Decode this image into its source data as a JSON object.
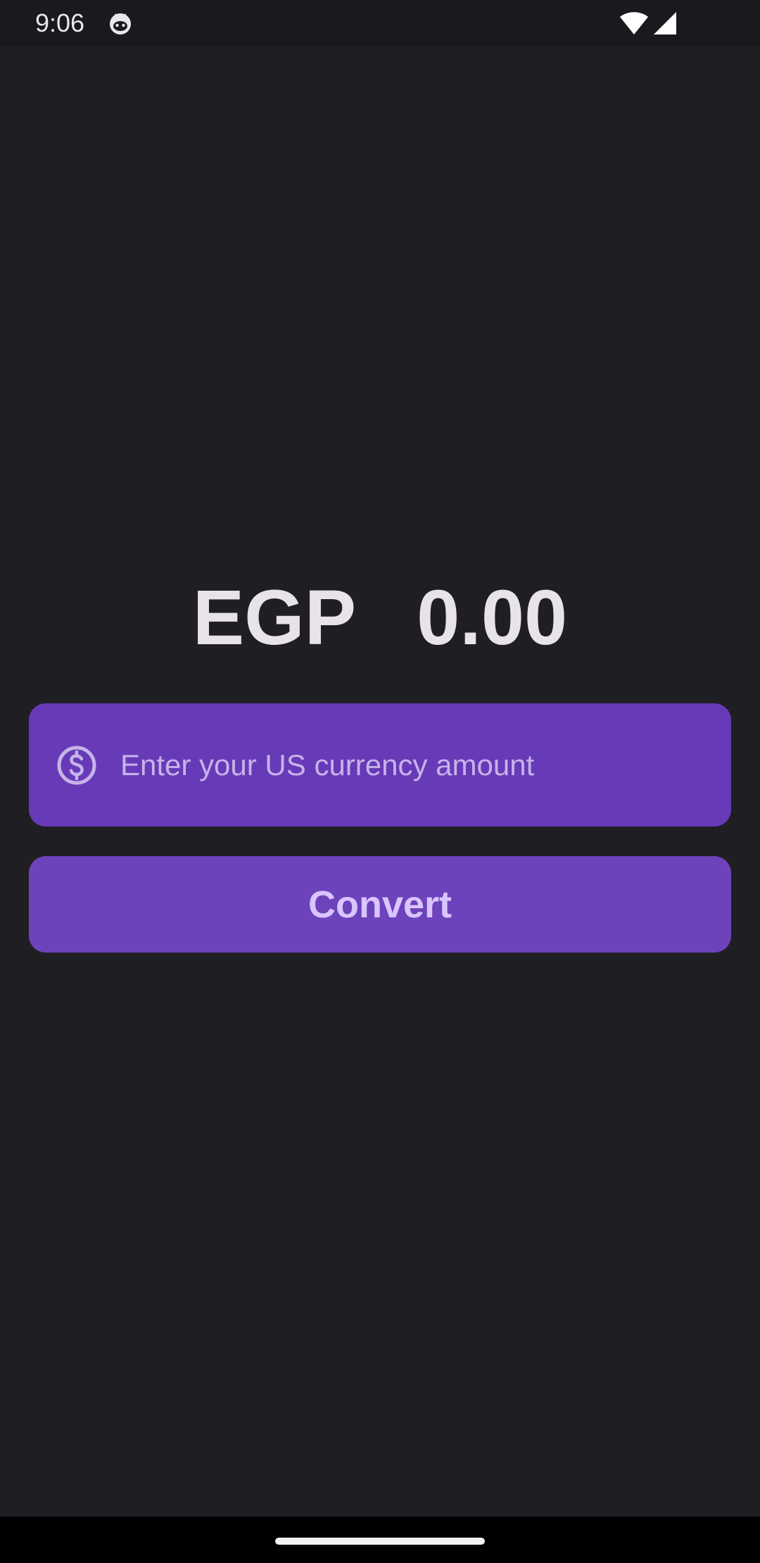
{
  "status_bar": {
    "time": "9:06",
    "app_icon": "cat-face-icon",
    "wifi_icon": "wifi-icon",
    "signal_icon": "cell-signal-icon"
  },
  "result": {
    "currency": "EGP",
    "amount": "0.00"
  },
  "amount_field": {
    "icon": "dollar-circle-icon",
    "value": "",
    "placeholder": "Enter your US currency amount"
  },
  "convert_button": {
    "label": "Convert"
  },
  "colors": {
    "background": "#1f1e23",
    "field": "#673ab7",
    "button": "#6d43bb",
    "button_text": "#d9c5ff",
    "placeholder": "#c6b3ea"
  }
}
